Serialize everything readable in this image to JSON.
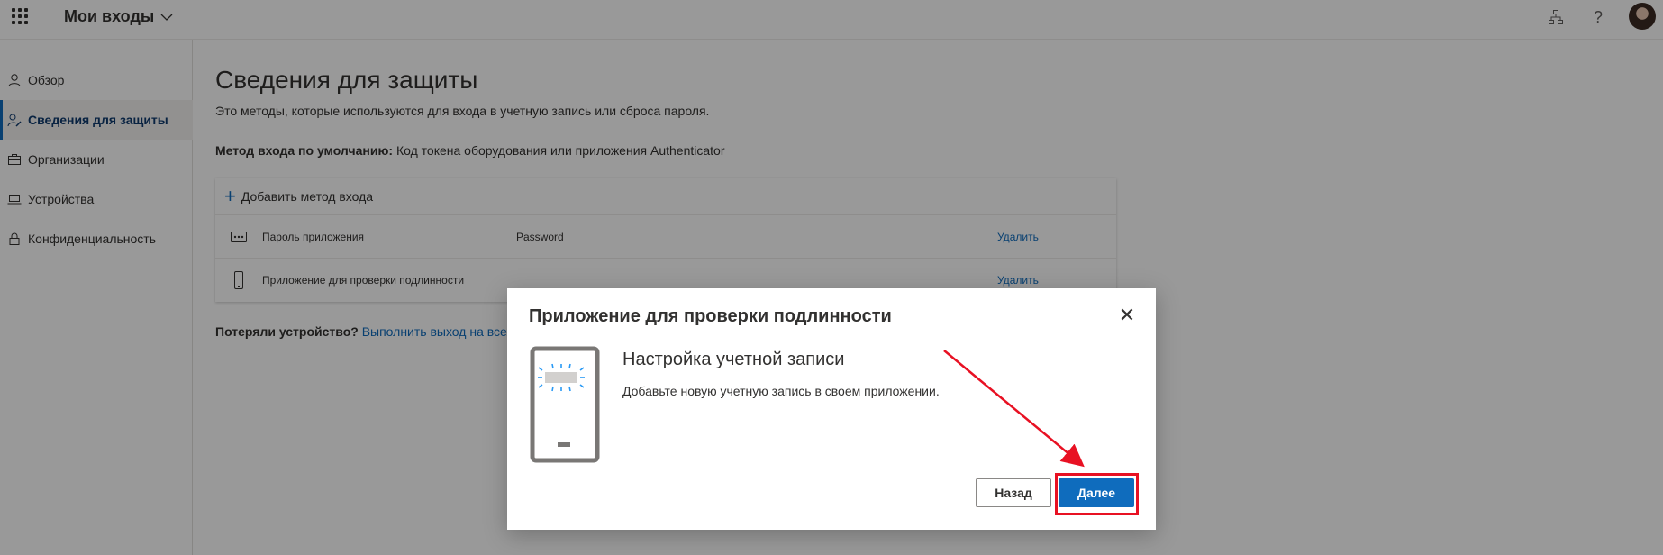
{
  "topbar": {
    "app_title": "Мои входы",
    "icons": [
      "waffle-icon",
      "chevron-down-icon",
      "org-chart-icon",
      "help-icon",
      "avatar"
    ],
    "help_glyph": "?"
  },
  "sidebar": {
    "items": [
      {
        "label": "Обзор",
        "icon": "person-icon",
        "active": false
      },
      {
        "label": "Сведения для защиты",
        "icon": "security-info-icon",
        "active": true
      },
      {
        "label": "Организации",
        "icon": "briefcase-icon",
        "active": false
      },
      {
        "label": "Устройства",
        "icon": "laptop-icon",
        "active": false
      },
      {
        "label": "Конфиденциальность",
        "icon": "lock-icon",
        "active": false
      }
    ]
  },
  "main": {
    "title": "Сведения для защиты",
    "subtitle": "Это методы, которые используются для входа в учетную запись или сброса пароля.",
    "default_method_label": "Метод входа по умолчанию:",
    "default_method_value": " Код токена оборудования или приложения Authenticator",
    "add_method": "Добавить метод входа",
    "methods": [
      {
        "name": "Пароль приложения",
        "detail": "Password",
        "action": "Удалить",
        "icon": "password-dots-icon"
      },
      {
        "name": "Приложение для проверки подлинности",
        "detail": "",
        "action": "Удалить",
        "icon": "phone-icon"
      }
    ],
    "lost_device_label": "Потеряли устройство?",
    "lost_device_link": "Выполнить выход на всех"
  },
  "dialog": {
    "title": "Приложение для проверки подлинности",
    "heading": "Настройка учетной записи",
    "text": "Добавьте новую учетную запись в своем приложении.",
    "back_button": "Назад",
    "next_button": "Далее"
  },
  "colors": {
    "accent": "#0f6cbd",
    "annotation": "#e81123",
    "overlay": "rgba(0,0,0,0.4)"
  }
}
